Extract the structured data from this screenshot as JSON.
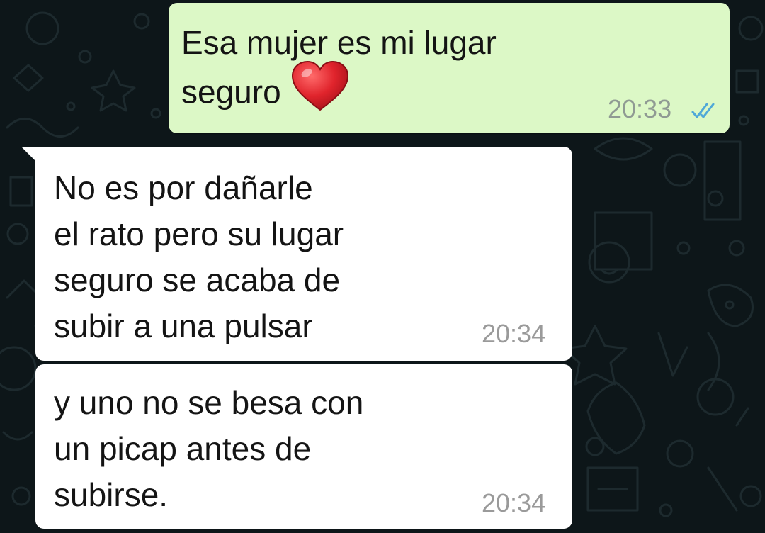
{
  "chat": {
    "messages": [
      {
        "direction": "outgoing",
        "text": "Esa mujer es mi lugar\nseguro",
        "emoji": "heart-emoji",
        "time": "20:33",
        "status": "double-check-read",
        "status_color": "#4fa8d8"
      },
      {
        "direction": "incoming",
        "text": "No es por dañarle\nel rato pero su lugar\nseguro se acaba de\nsubir a una pulsar",
        "time": "20:34"
      },
      {
        "direction": "incoming",
        "text": "y uno no se besa con\nun picap antes de\nsubirse.",
        "time": "20:34"
      }
    ]
  },
  "colors": {
    "background": "#0d1619",
    "outgoing_bubble": "#dcf8c6",
    "incoming_bubble": "#ffffff",
    "heart": "#e0242c"
  }
}
